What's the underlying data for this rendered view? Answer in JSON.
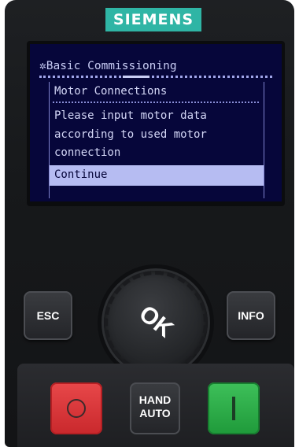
{
  "brand": {
    "logo_text": "SIEMENS",
    "logo_color": "#2fb5a5"
  },
  "display": {
    "title_icon": "star-icon",
    "title": "Basic Commissioning",
    "dialog": {
      "header": "Motor Connections",
      "message": "Please input motor data\naccording to used motor\nconnection",
      "selected_option": "Continue"
    },
    "colors": {
      "background": "#06063a",
      "text": "#d4d7f7",
      "highlight": "#b6bcf2"
    }
  },
  "keypad": {
    "esc_label": "ESC",
    "info_label": "INFO",
    "ok_label": "OK",
    "hand_label_top": "HAND",
    "hand_label_bottom": "AUTO",
    "stop_glyph": "O",
    "start_glyph": "I",
    "stop_color": "#d8383b",
    "start_color": "#2fae4a"
  }
}
